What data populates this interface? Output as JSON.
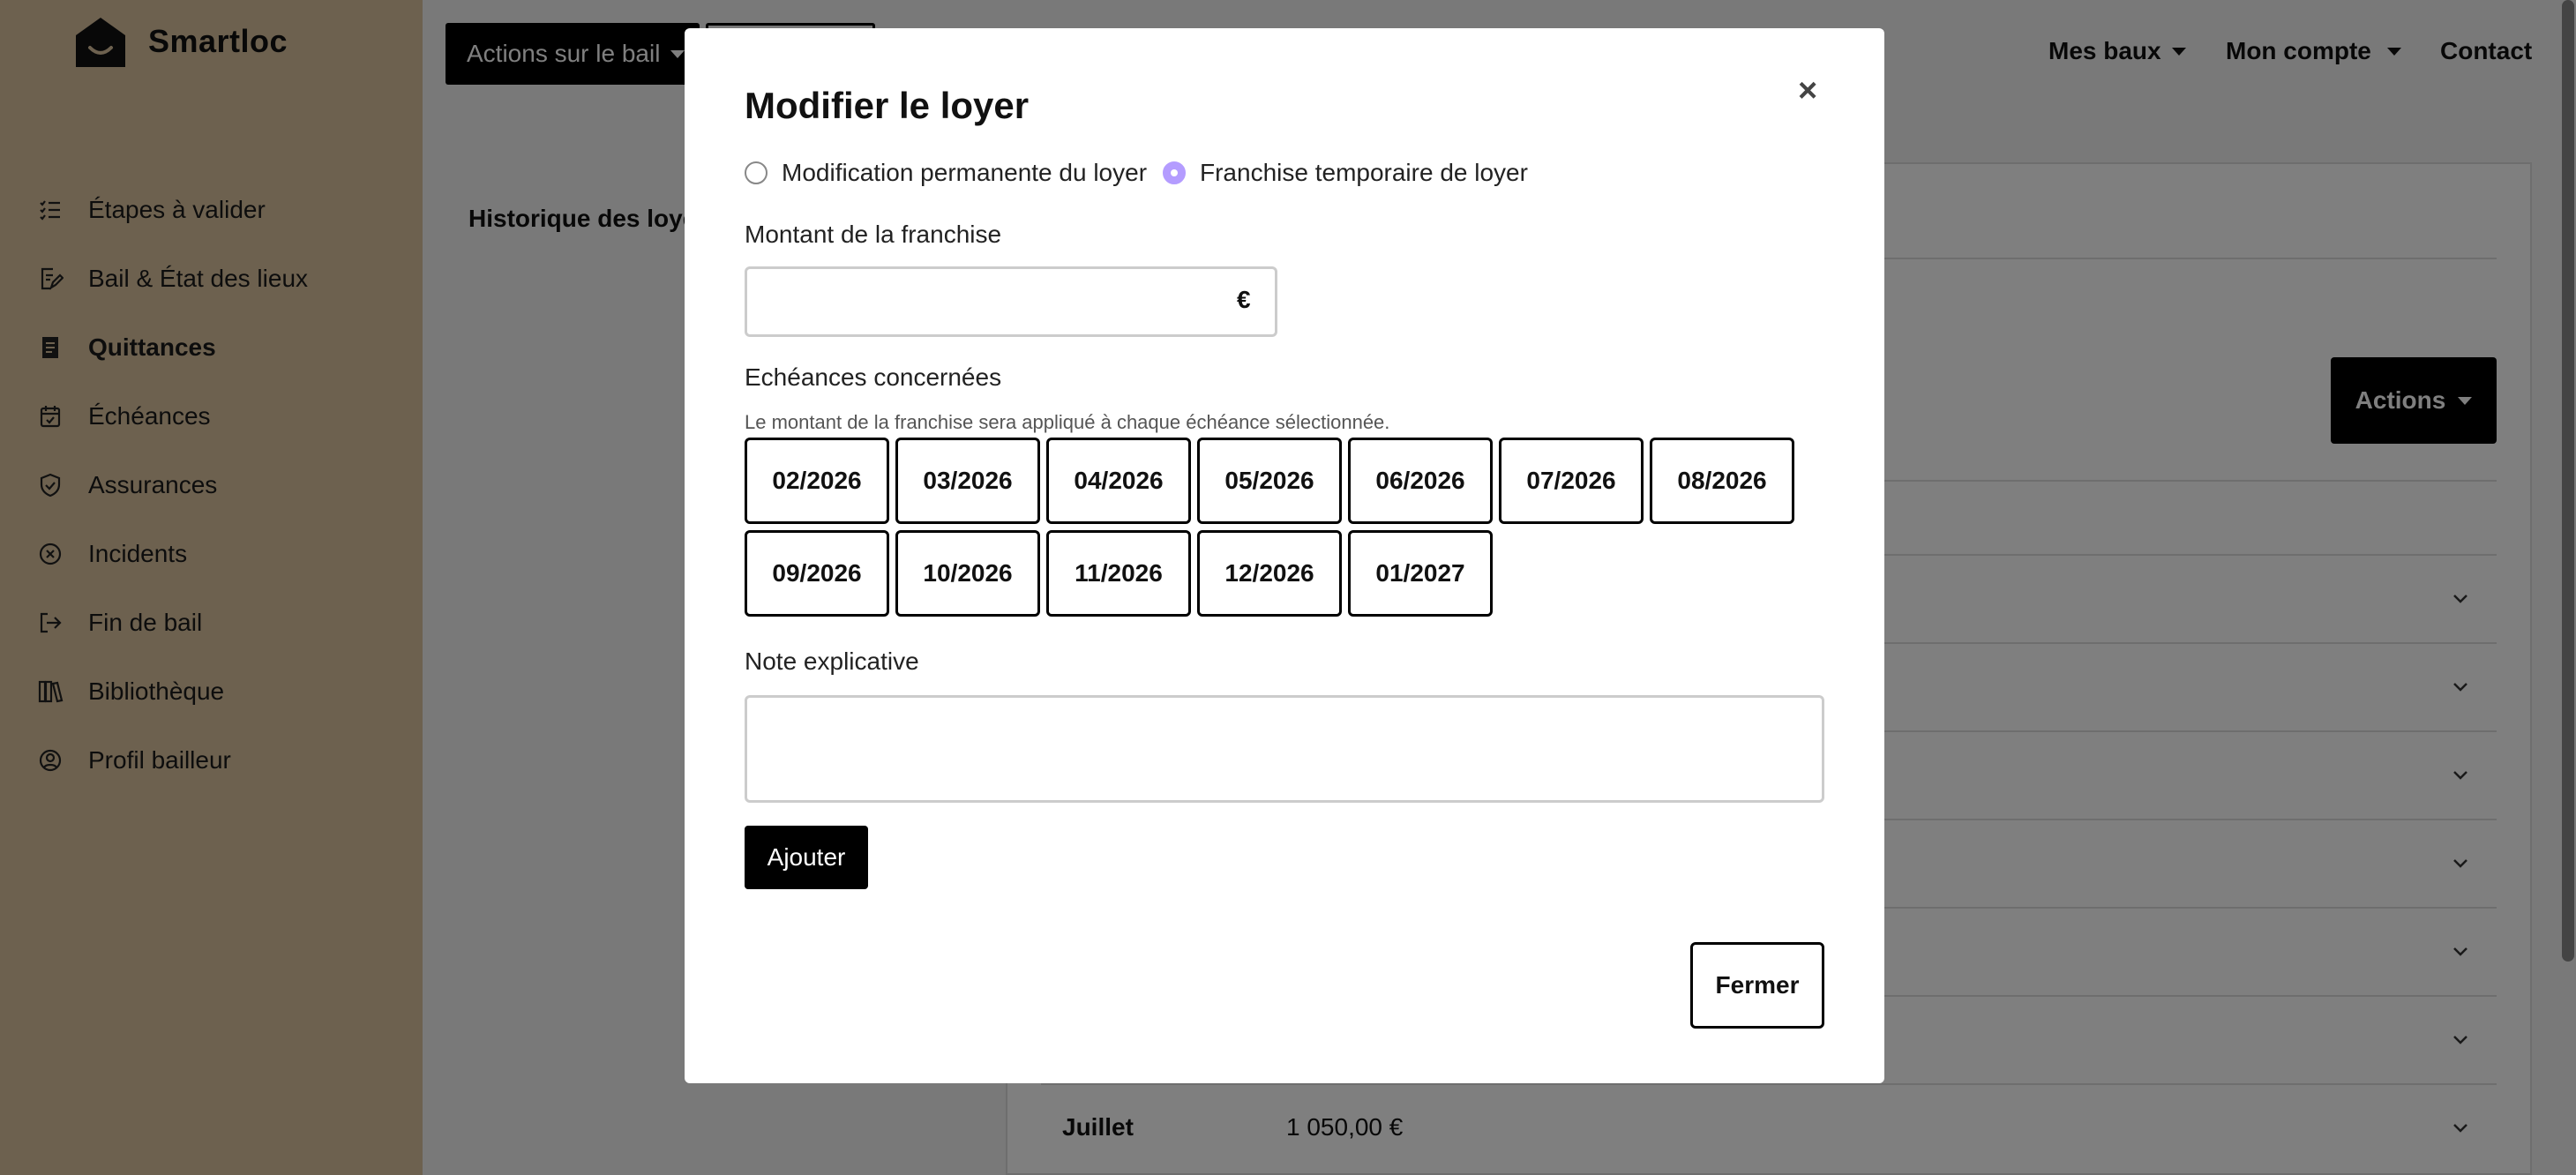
{
  "app": {
    "name": "Smartloc"
  },
  "sidebar": {
    "items": [
      {
        "label": "Étapes à valider",
        "icon": "list-check-icon"
      },
      {
        "label": "Bail & État des lieux",
        "icon": "file-edit-icon"
      },
      {
        "label": "Quittances",
        "icon": "receipt-icon",
        "active": true
      },
      {
        "label": "Échéances",
        "icon": "calendar-check-icon"
      },
      {
        "label": "Assurances",
        "icon": "shield-check-icon"
      },
      {
        "label": "Incidents",
        "icon": "circle-x-icon"
      },
      {
        "label": "Fin de bail",
        "icon": "exit-arrow-icon"
      },
      {
        "label": "Bibliothèque",
        "icon": "books-icon"
      },
      {
        "label": "Profil bailleur",
        "icon": "user-circle-icon"
      }
    ]
  },
  "header": {
    "actions_bail_label": "Actions sur le bail",
    "nav": {
      "mes_baux": "Mes baux",
      "mon_compte": "Mon compte",
      "contact": "Contact"
    }
  },
  "page": {
    "history_title": "Historique des loye",
    "actions_label": "Actions",
    "visible_row": {
      "month": "Juillet",
      "amount": "1 050,00 €"
    }
  },
  "modal": {
    "title": "Modifier le loyer",
    "close_symbol": "×",
    "radio_permanent": "Modification permanente du loyer",
    "radio_temporary": "Franchise temporaire de loyer",
    "selected_option": "temporary",
    "amount_label": "Montant de la franchise",
    "amount_value": "",
    "currency": "€",
    "due_dates_label": "Echéances concernées",
    "due_dates_help": "Le montant de la franchise sera appliqué à chaque échéance sélectionnée.",
    "due_dates": [
      "02/2026",
      "03/2026",
      "04/2026",
      "05/2026",
      "06/2026",
      "07/2026",
      "08/2026",
      "09/2026",
      "10/2026",
      "11/2026",
      "12/2026",
      "01/2027"
    ],
    "note_label": "Note explicative",
    "note_value": "",
    "add_label": "Ajouter",
    "close_label": "Fermer"
  },
  "colors": {
    "sidebar_bg": "#dac39f",
    "radio_accent": "#b49cff",
    "primary_button": "#000000"
  }
}
